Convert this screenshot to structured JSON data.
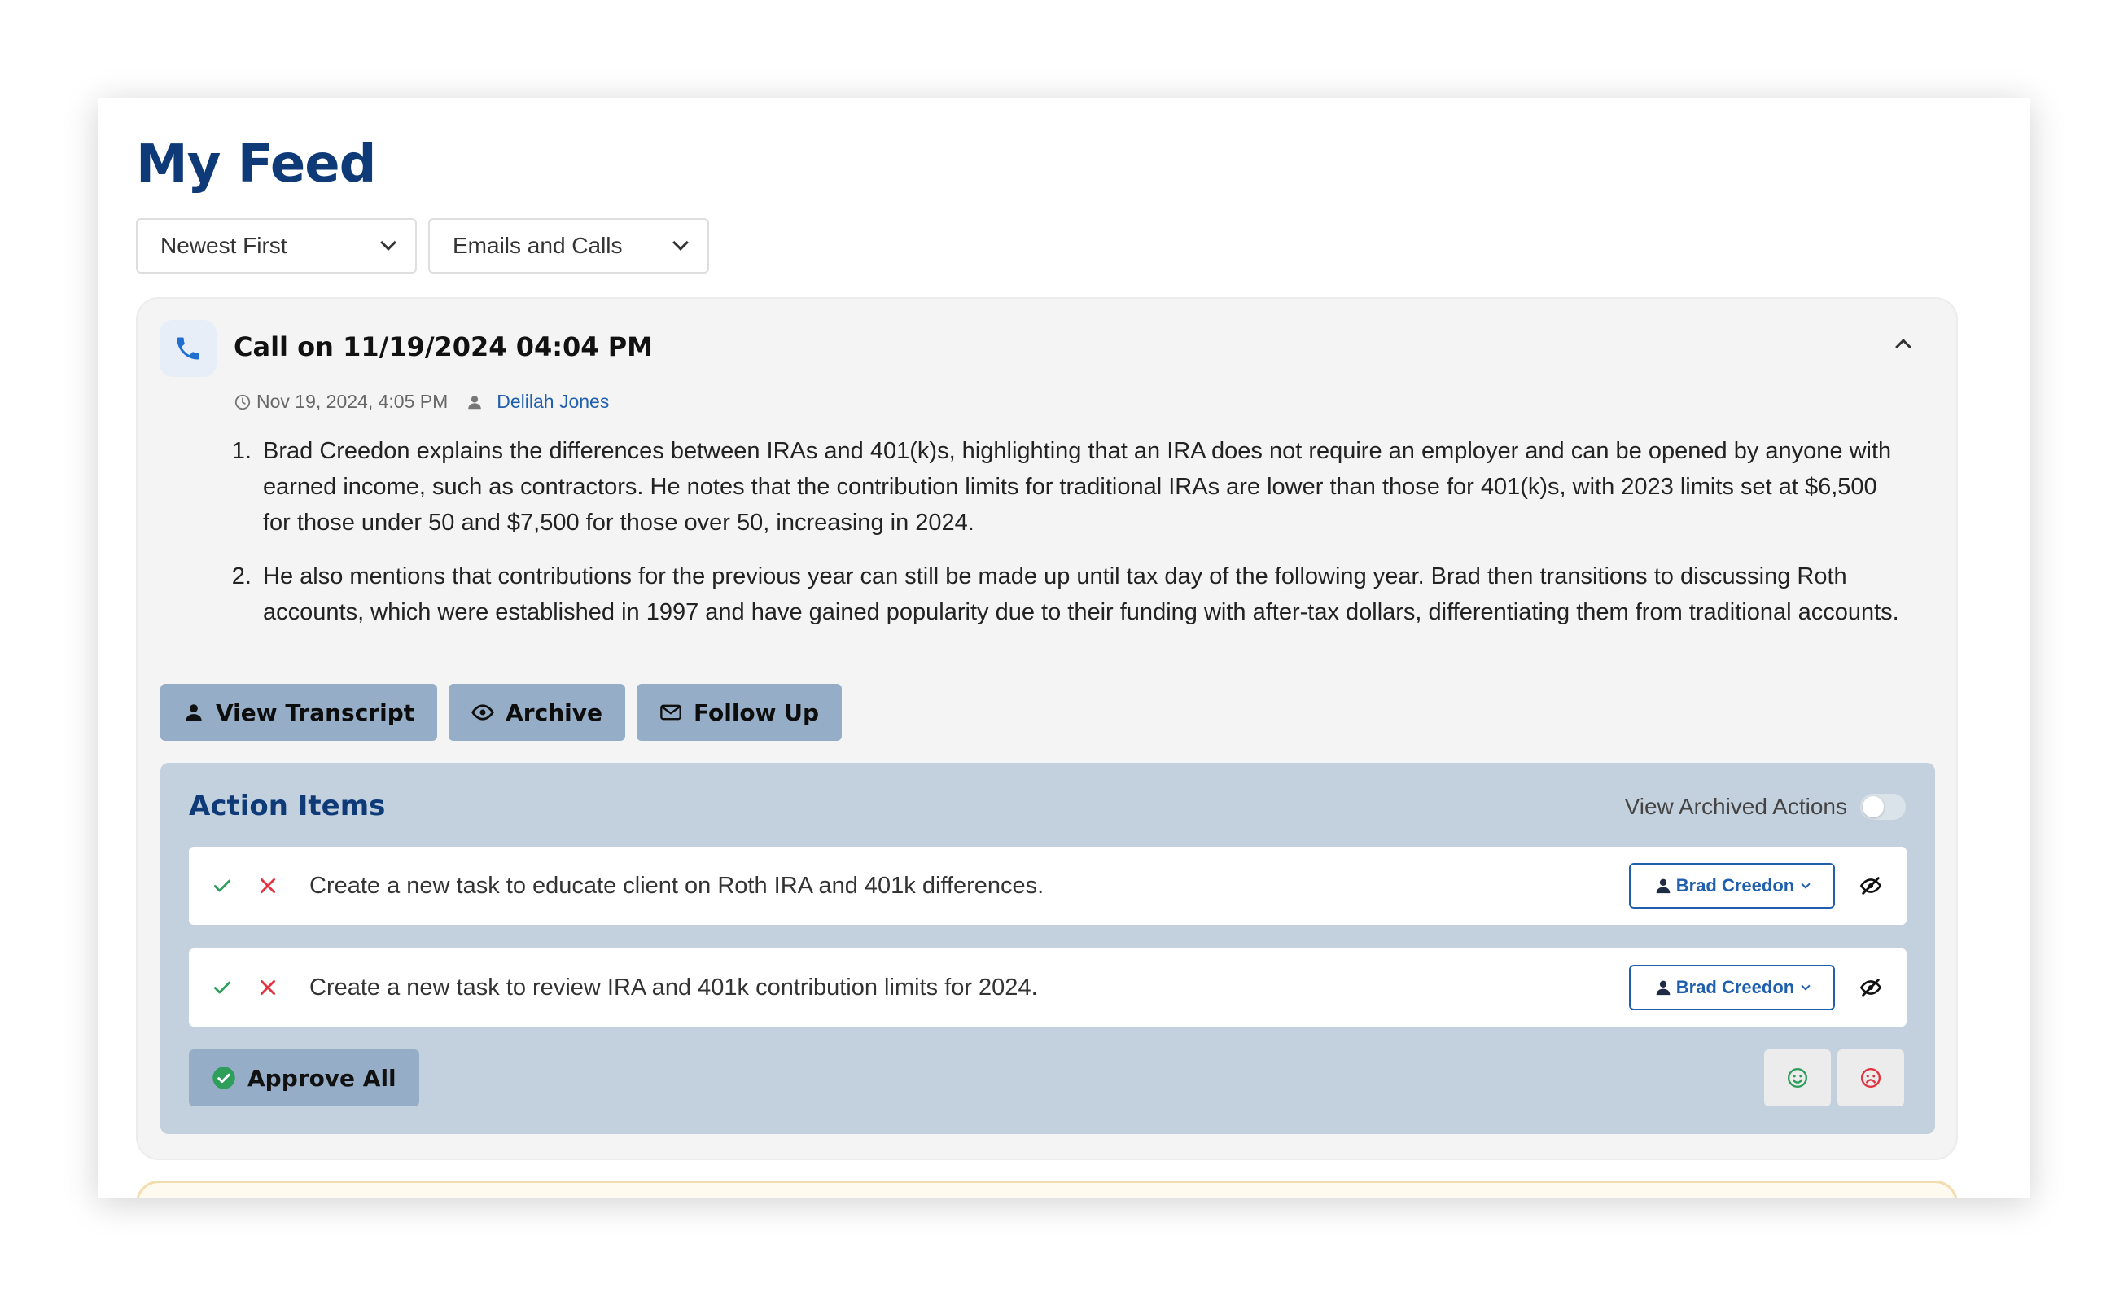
{
  "page": {
    "title": "My Feed"
  },
  "filters": {
    "sort": {
      "selected": "Newest First"
    },
    "type": {
      "selected": "Emails and Calls"
    }
  },
  "call": {
    "title": "Call on 11/19/2024 04:04 PM",
    "timestamp": "Nov 19, 2024, 4:05 PM",
    "author": "Delilah Jones",
    "summary": [
      "Brad Creedon explains the differences between IRAs and 401(k)s, highlighting that an IRA does not require an employer and can be opened by anyone with earned income, such as contractors. He notes that the contribution limits for traditional IRAs are lower than those for 401(k)s, with 2023 limits set at $6,500 for those under 50 and $7,500 for those over 50, increasing in 2024.",
      "He also mentions that contributions for the previous year can still be made up until tax day of the following year. Brad then transitions to discussing Roth accounts, which were established in 1997 and have gained popularity due to their funding with after-tax dollars, differentiating them from traditional accounts."
    ],
    "buttons": {
      "view_transcript": "View Transcript",
      "archive": "Archive",
      "follow_up": "Follow Up"
    }
  },
  "action_items": {
    "title": "Action Items",
    "view_archived_label": "View Archived Actions",
    "items": [
      {
        "text": "Create a new task to educate client on Roth IRA and 401k differences.",
        "assignee": "Brad Creedon"
      },
      {
        "text": "Create a new task to review IRA and 401k contribution limits for 2024.",
        "assignee": "Brad Creedon"
      }
    ],
    "approve_all_label": "Approve All"
  },
  "colors": {
    "brand_navy": "#0f3a78",
    "link_blue": "#1f5fae",
    "button_bg": "#96adc7",
    "panel_bg": "#c3d1de",
    "approve_green": "#2e9e5b",
    "reject_red": "#e0333f"
  },
  "icons": [
    "chevron-down-icon",
    "phone-icon",
    "chevron-up-icon",
    "clock-icon",
    "user-icon",
    "eye-icon",
    "envelope-icon",
    "check-icon",
    "close-icon",
    "eye-off-icon",
    "check-circle-icon",
    "smile-icon",
    "frown-icon"
  ]
}
